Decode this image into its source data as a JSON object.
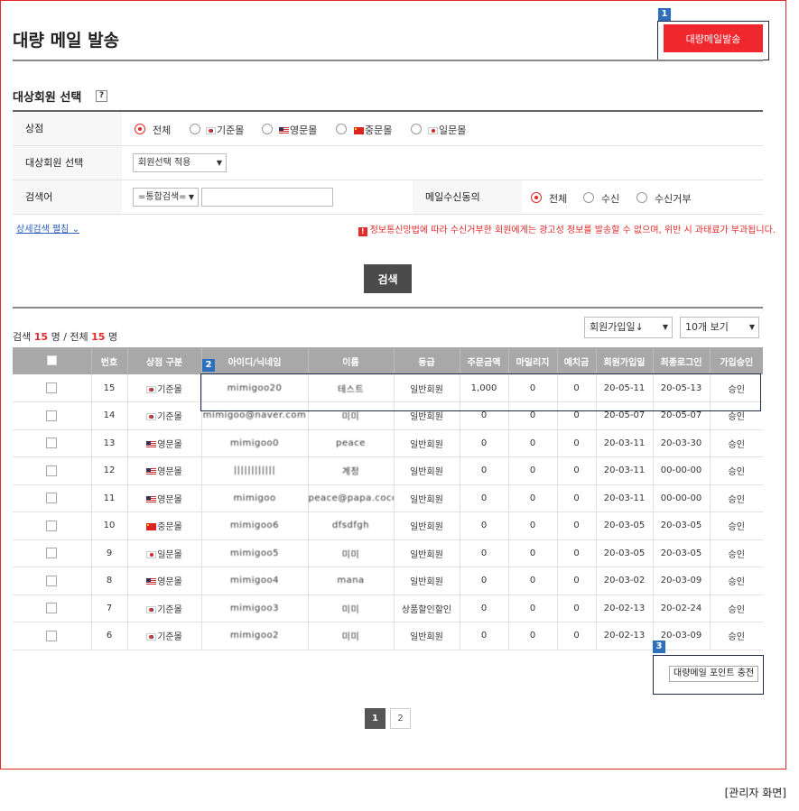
{
  "page": {
    "title": "대량 메일 발송",
    "bulk_button": "대량메일발송"
  },
  "callouts": [
    "1",
    "2",
    "3"
  ],
  "target_section": {
    "title": "대상회원 선택",
    "help": "?"
  },
  "form": {
    "store": {
      "label": "상점",
      "options": [
        {
          "label": "전체",
          "flag": "",
          "selected": true
        },
        {
          "label": "기준몰",
          "flag": "kr",
          "selected": false
        },
        {
          "label": "영문몰",
          "flag": "us",
          "selected": false
        },
        {
          "label": "중문몰",
          "flag": "cn",
          "selected": false
        },
        {
          "label": "일문몰",
          "flag": "jp",
          "selected": false
        }
      ]
    },
    "member_select": {
      "label": "대상회원 선택",
      "value": "회원선택 적용"
    },
    "keyword": {
      "label": "검색어",
      "select_value": "=통합검색=",
      "input_value": ""
    },
    "mail_consent": {
      "label": "메일수신동의",
      "options": [
        {
          "label": "전체",
          "selected": true
        },
        {
          "label": "수신",
          "selected": false
        },
        {
          "label": "수신거부",
          "selected": false
        }
      ]
    },
    "detail_link": "상세검색 펼침",
    "warning": "정보통신망법에 따라 수신거부한 회원에게는 광고성 정보를 발송할 수 없으며, 위반 시 과태료가 부과됩니다.",
    "search_button": "검색"
  },
  "results": {
    "count_prefix": "검색",
    "found": "15",
    "unit": "명",
    "sep": "/ 전체",
    "total": "15",
    "unit2": "명",
    "sort_value": "회원가입일↓",
    "view_value": "10개 보기"
  },
  "table": {
    "headers": [
      "",
      "번호",
      "상점 구분",
      "아이디/닉네임",
      "이름",
      "등급",
      "주문금액",
      "마일리지",
      "예치금",
      "회원가입일",
      "최종로그인",
      "가입승인"
    ],
    "rows": [
      {
        "no": "15",
        "flag": "kr",
        "store": "기준몰",
        "id": "mimigoo20",
        "name": "테스트",
        "grade": "일반회원",
        "order": "1,000",
        "mileage": "0",
        "deposit": "0",
        "joined": "20-05-11",
        "last_login": "20-05-13",
        "approved": "승인"
      },
      {
        "no": "14",
        "flag": "kr",
        "store": "기준몰",
        "id": "mimigoo@naver.com",
        "name": "미미",
        "grade": "일반회원",
        "order": "0",
        "mileage": "0",
        "deposit": "0",
        "joined": "20-05-07",
        "last_login": "20-05-07",
        "approved": "승인"
      },
      {
        "no": "13",
        "flag": "us",
        "store": "영문몰",
        "id": "mimigoo0",
        "name": "peace",
        "grade": "일반회원",
        "order": "0",
        "mileage": "0",
        "deposit": "0",
        "joined": "20-03-11",
        "last_login": "20-03-30",
        "approved": "승인"
      },
      {
        "no": "12",
        "flag": "us",
        "store": "영문몰",
        "id": "||||||||||||",
        "name": "계정",
        "grade": "일반회원",
        "order": "0",
        "mileage": "0",
        "deposit": "0",
        "joined": "20-03-11",
        "last_login": "00-00-00",
        "approved": "승인"
      },
      {
        "no": "11",
        "flag": "us",
        "store": "영문몰",
        "id": "mimigoo",
        "name": "peace@papa.coco",
        "grade": "일반회원",
        "order": "0",
        "mileage": "0",
        "deposit": "0",
        "joined": "20-03-11",
        "last_login": "00-00-00",
        "approved": "승인"
      },
      {
        "no": "10",
        "flag": "cn",
        "store": "중문몰",
        "id": "mimigoo6",
        "name": "dfsdfgh",
        "grade": "일반회원",
        "order": "0",
        "mileage": "0",
        "deposit": "0",
        "joined": "20-03-05",
        "last_login": "20-03-05",
        "approved": "승인"
      },
      {
        "no": "9",
        "flag": "jp",
        "store": "일문몰",
        "id": "mimigoo5",
        "name": "미미",
        "grade": "일반회원",
        "order": "0",
        "mileage": "0",
        "deposit": "0",
        "joined": "20-03-05",
        "last_login": "20-03-05",
        "approved": "승인"
      },
      {
        "no": "8",
        "flag": "us",
        "store": "영문몰",
        "id": "mimigoo4",
        "name": "mana",
        "grade": "일반회원",
        "order": "0",
        "mileage": "0",
        "deposit": "0",
        "joined": "20-03-02",
        "last_login": "20-03-09",
        "approved": "승인"
      },
      {
        "no": "7",
        "flag": "kr",
        "store": "기준몰",
        "id": "mimigoo3",
        "name": "미미",
        "grade": "상품할인할인",
        "order": "0",
        "mileage": "0",
        "deposit": "0",
        "joined": "20-02-13",
        "last_login": "20-02-24",
        "approved": "승인"
      },
      {
        "no": "6",
        "flag": "kr",
        "store": "기준몰",
        "id": "mimigoo2",
        "name": "미미",
        "grade": "일반회원",
        "order": "0",
        "mileage": "0",
        "deposit": "0",
        "joined": "20-02-13",
        "last_login": "20-03-09",
        "approved": "승인"
      }
    ]
  },
  "charge_button": "대량메일 포인트 충전",
  "pagination": [
    "1",
    "2"
  ],
  "caption": "[관리자 화면]",
  "colors": {
    "accent_red": "#f0282d",
    "header_gray": "#a8a8a8",
    "badge_blue": "#2e6fbd",
    "dark_button": "#4b4b4b"
  }
}
